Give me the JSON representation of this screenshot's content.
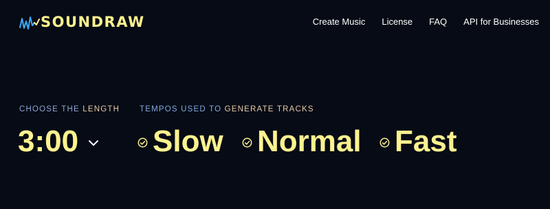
{
  "brand": {
    "name": "SOUNDRAW",
    "logo_icon": "wave-icon"
  },
  "nav": [
    {
      "label": "Create Music"
    },
    {
      "label": "License"
    },
    {
      "label": "FAQ"
    },
    {
      "label": "API for Businesses"
    }
  ],
  "length": {
    "label_a": "CHOOSE THE ",
    "label_b": "LENGTH",
    "value": "3:00",
    "icon": "chevron-down-icon"
  },
  "tempos": {
    "label_a": "TEMPOS USED TO ",
    "label_b": "GENERATE TRACKS",
    "options": [
      {
        "label": "Slow",
        "checked": true
      },
      {
        "label": "Normal",
        "checked": true
      },
      {
        "label": "Fast",
        "checked": true
      }
    ]
  },
  "colors": {
    "background": "#060b15",
    "accent_yellow": "#fdf28f",
    "label_blue": "#7fa7e2",
    "logo_blue": "#3fa9f5"
  }
}
